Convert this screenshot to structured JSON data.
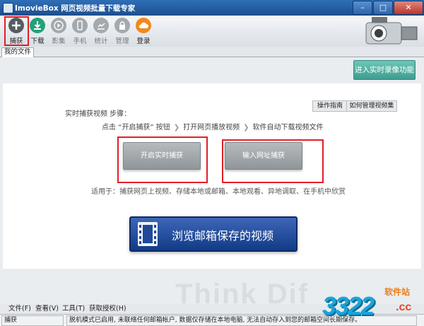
{
  "window": {
    "title": "ImovieBox 网页视频批量下载专家",
    "minimize": "–",
    "maximize": "□",
    "close": "✕"
  },
  "toolbar": {
    "capture": "捕获",
    "download": "下载",
    "library": "影集",
    "phone": "手机",
    "stats": "统计",
    "manage": "管理",
    "login": "登录"
  },
  "tabs": {
    "my_files": "我的文件"
  },
  "main": {
    "live_record_btn": "进入实时录像功能",
    "guide_btn": "操作指南",
    "manage_albums_btn": "如何管理视频集",
    "steps_title": "实时捕获视频 步骤：",
    "step1": "点击 “开启捕获” 按钮",
    "step2": "打开网页播放视频",
    "step3": "软件自动下载视频文件",
    "start_capture_btn": "开启实时捕获",
    "input_url_btn": "输入网址捕获",
    "apply_text": "适用于：捕获网页上视频、存储本地或邮箱、本地观看、异地调取、在手机中欣赏",
    "browse_btn": "浏览邮箱保存的视频",
    "watermark": "Think Dif"
  },
  "menu": {
    "file": "文件(F)",
    "view": "查看(V)",
    "tools": "工具(T)",
    "license": "获取授权(H)"
  },
  "status": {
    "left": "捕获",
    "message": "脱机模式已启用, 未联络任何邮箱帐户, 数据仅存储在本地电脑, 无法自动存入到您的邮箱空间长期保存。"
  },
  "site_logo": {
    "cn": "软件站",
    "num": "3322",
    "domain": ".cc"
  },
  "colors": {
    "title_bar": "#2f6fb7",
    "highlight": "#e01f26",
    "teal": "#4fae9f",
    "browse": "#1f4a9a",
    "login": "#f08a1c"
  }
}
